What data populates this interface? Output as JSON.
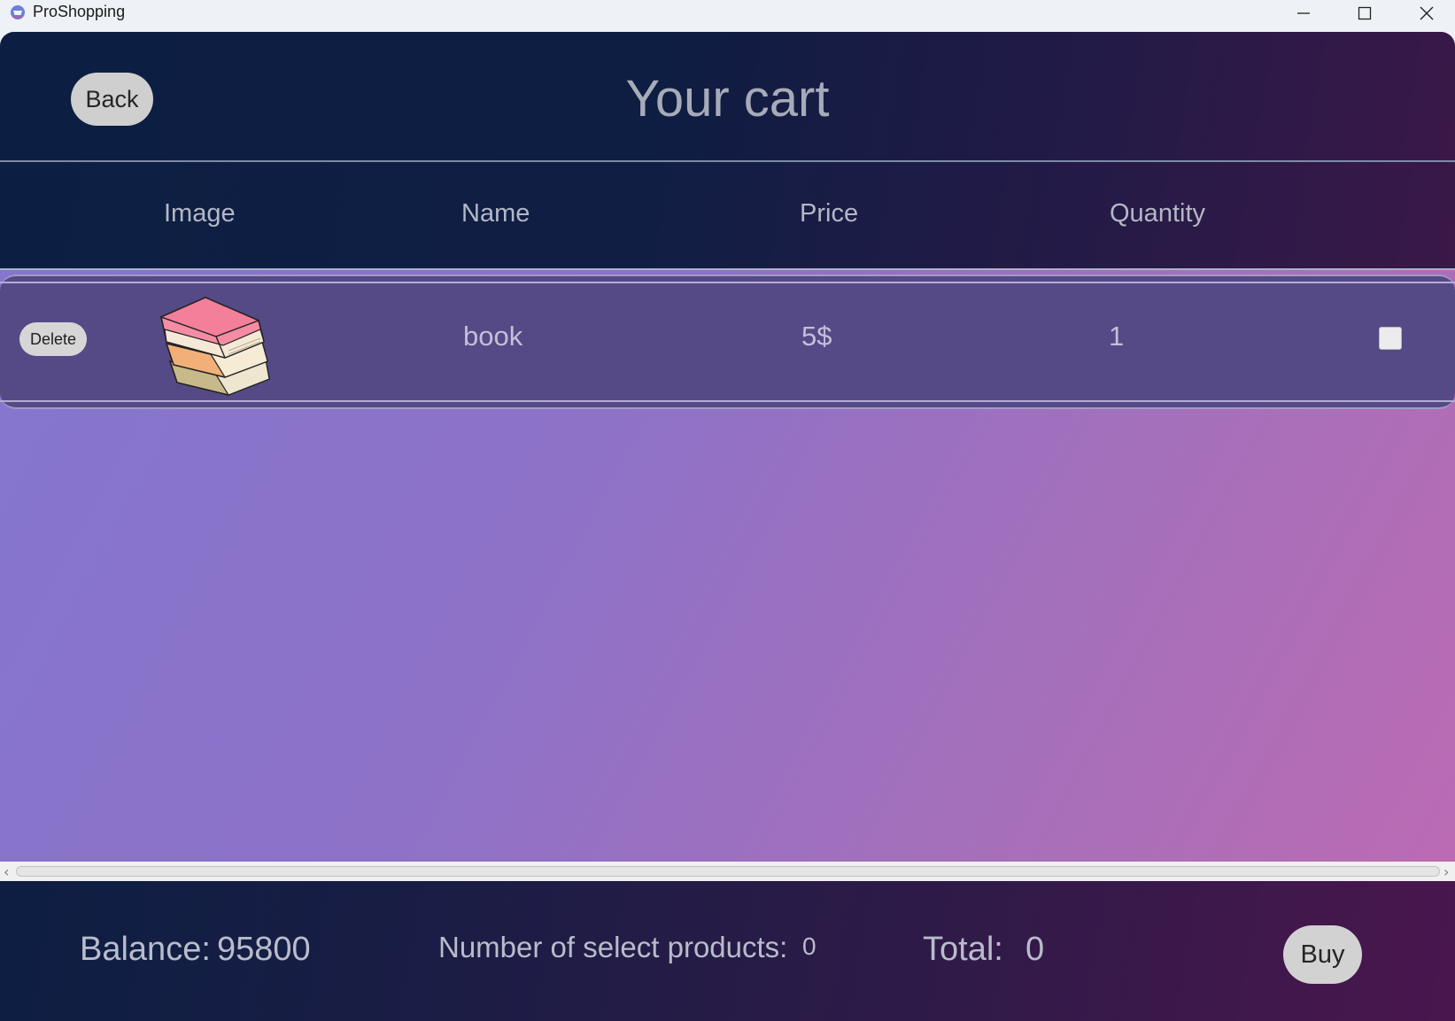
{
  "window": {
    "title": "ProShopping"
  },
  "header": {
    "back_label": "Back",
    "title": "Your cart"
  },
  "columns": [
    "Image",
    "Name",
    "Price",
    "Quantity"
  ],
  "cart_items": [
    {
      "delete_label": "Delete",
      "image": "book-stack-icon",
      "name": "book",
      "price": "5$",
      "quantity": "1",
      "selected": false
    }
  ],
  "footer": {
    "balance_label": "Balance:",
    "balance_value": "95800",
    "selected_label": "Number of select products:",
    "selected_value": "0",
    "total_label": "Total:",
    "total_value": "0",
    "buy_label": "Buy"
  },
  "colors": {
    "header_bg": "#0c1f42",
    "row_bg": "#554a86",
    "gradient_start": "#8377cf",
    "gradient_end": "#be6ab2"
  }
}
